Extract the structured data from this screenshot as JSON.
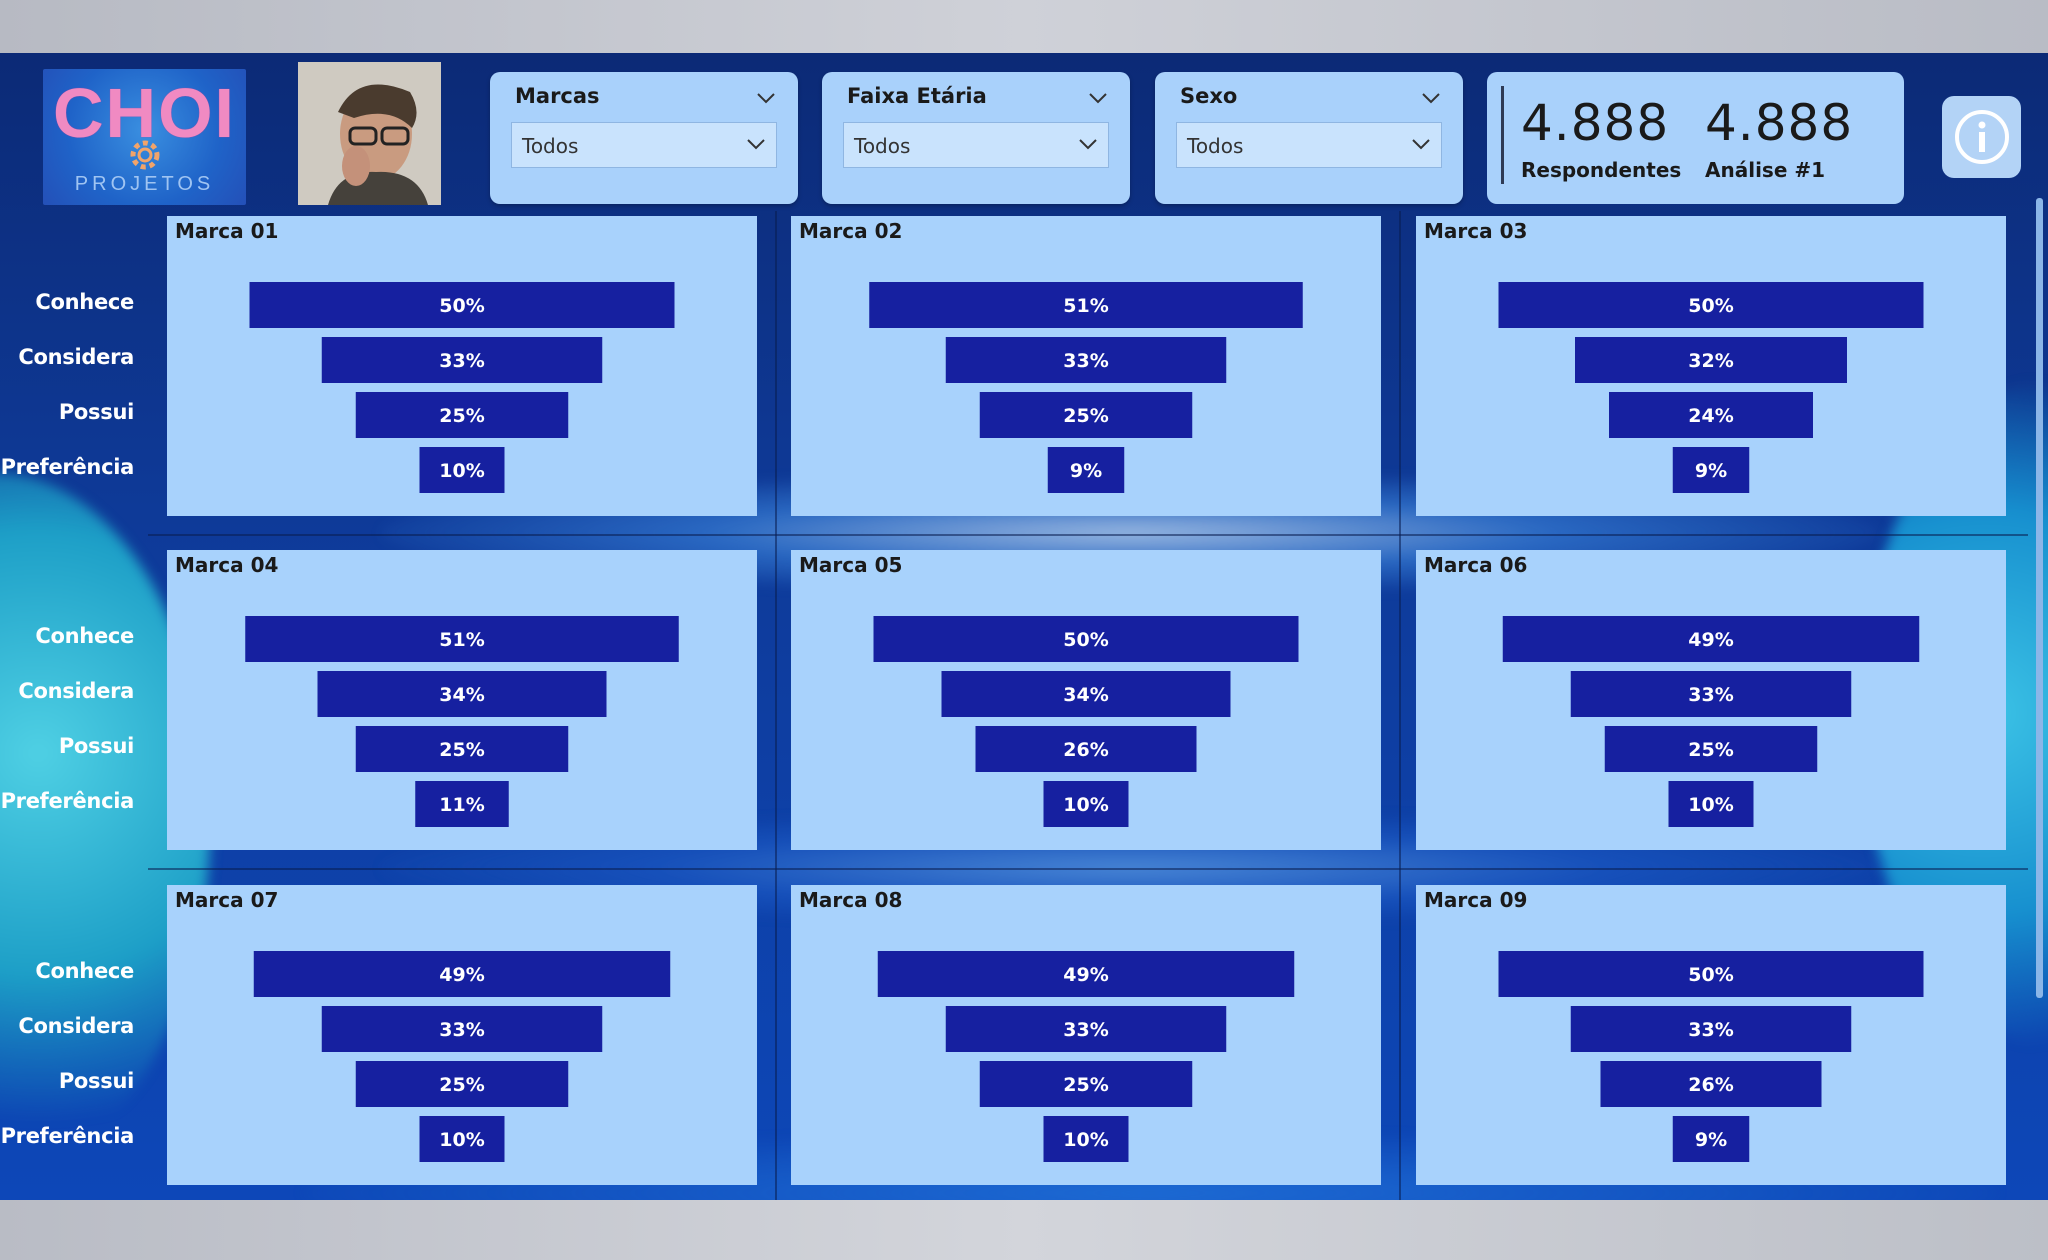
{
  "filters": [
    {
      "title": "Marcas",
      "value": "Todos"
    },
    {
      "title": "Faixa Etária",
      "value": "Todos"
    },
    {
      "title": "Sexo",
      "value": "Todos"
    }
  ],
  "kpis": [
    {
      "value": "4.888",
      "label": "Respondentes"
    },
    {
      "value": "4.888",
      "label": "Análise #1"
    }
  ],
  "logo": {
    "brand": "CHOI",
    "sub": "PROJETOS"
  },
  "stages": [
    "Conhece",
    "Considera",
    "Possui",
    "Preferência"
  ],
  "colors": {
    "bar": "#1620a0",
    "panel": "#a8d2fc",
    "label": "#ffffff"
  },
  "chart_data": [
    {
      "type": "funnel",
      "title": "Marca 01",
      "categories": [
        "Conhece",
        "Considera",
        "Possui",
        "Preferência"
      ],
      "values": [
        50,
        33,
        25,
        10
      ],
      "labels": [
        "50%",
        "33%",
        "25%",
        "10%"
      ]
    },
    {
      "type": "funnel",
      "title": "Marca 02",
      "categories": [
        "Conhece",
        "Considera",
        "Possui",
        "Preferência"
      ],
      "values": [
        51,
        33,
        25,
        9
      ],
      "labels": [
        "51%",
        "33%",
        "25%",
        "9%"
      ]
    },
    {
      "type": "funnel",
      "title": "Marca 03",
      "categories": [
        "Conhece",
        "Considera",
        "Possui",
        "Preferência"
      ],
      "values": [
        50,
        32,
        24,
        9
      ],
      "labels": [
        "50%",
        "32%",
        "24%",
        "9%"
      ]
    },
    {
      "type": "funnel",
      "title": "Marca 04",
      "categories": [
        "Conhece",
        "Considera",
        "Possui",
        "Preferência"
      ],
      "values": [
        51,
        34,
        25,
        11
      ],
      "labels": [
        "51%",
        "34%",
        "25%",
        "11%"
      ]
    },
    {
      "type": "funnel",
      "title": "Marca 05",
      "categories": [
        "Conhece",
        "Considera",
        "Possui",
        "Preferência"
      ],
      "values": [
        50,
        34,
        26,
        10
      ],
      "labels": [
        "50%",
        "34%",
        "26%",
        "10%"
      ]
    },
    {
      "type": "funnel",
      "title": "Marca 06",
      "categories": [
        "Conhece",
        "Considera",
        "Possui",
        "Preferência"
      ],
      "values": [
        49,
        33,
        25,
        10
      ],
      "labels": [
        "49%",
        "33%",
        "25%",
        "10%"
      ]
    },
    {
      "type": "funnel",
      "title": "Marca 07",
      "categories": [
        "Conhece",
        "Considera",
        "Possui",
        "Preferência"
      ],
      "values": [
        49,
        33,
        25,
        10
      ],
      "labels": [
        "49%",
        "33%",
        "25%",
        "10%"
      ]
    },
    {
      "type": "funnel",
      "title": "Marca 08",
      "categories": [
        "Conhece",
        "Considera",
        "Possui",
        "Preferência"
      ],
      "values": [
        49,
        33,
        25,
        10
      ],
      "labels": [
        "49%",
        "33%",
        "25%",
        "10%"
      ]
    },
    {
      "type": "funnel",
      "title": "Marca 09",
      "categories": [
        "Conhece",
        "Considera",
        "Possui",
        "Preferência"
      ],
      "values": [
        50,
        33,
        26,
        9
      ],
      "labels": [
        "50%",
        "33%",
        "26%",
        "9%"
      ]
    }
  ]
}
